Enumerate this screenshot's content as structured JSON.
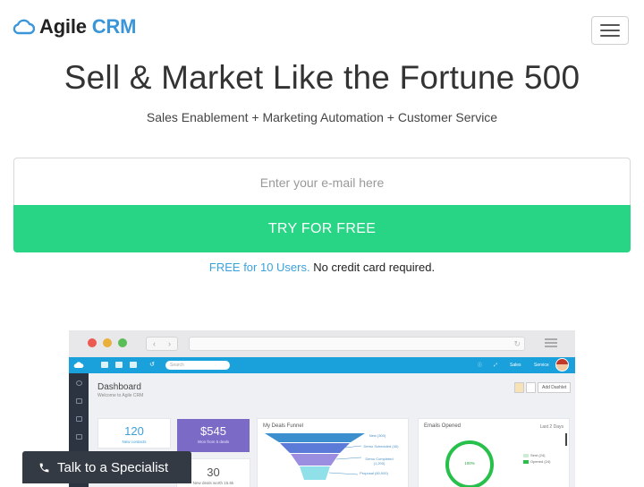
{
  "header": {
    "logo_word1": "Agile",
    "logo_word2": "CRM",
    "menu_icon": "hamburger-menu-icon"
  },
  "hero": {
    "headline": "Sell & Market Like the Fortune 500",
    "subheadline": "Sales Enablement + Marketing Automation + Customer Service"
  },
  "signup": {
    "email_placeholder": "Enter your e-mail here",
    "email_value": "",
    "cta_label": "TRY FOR FREE",
    "note_highlight": "FREE for 10 Users.",
    "note_rest": "No credit card required."
  },
  "preview": {
    "search_placeholder": "Search",
    "nav_sales": "Sales",
    "nav_service": "Service",
    "dashboard_title": "Dashboard",
    "dashboard_subtitle": "Welcome to Agile CRM",
    "add_dashlet_label": "Add Dashlet",
    "stats": [
      {
        "value": "120",
        "label": "New contacts"
      },
      {
        "value": "$545",
        "label": "Won from 5 deals"
      },
      {
        "value": "30",
        "label": "New deals worth 15.6k"
      }
    ],
    "funnel_title": "My Deals Funnel",
    "funnel_labels": [
      "New (300)",
      "Demo Scheduled (40)",
      "Demo Completed (1,200)",
      "Proposal (60,000)"
    ],
    "emails_title": "Emails Opened",
    "emails_range": "Last 2 Days",
    "emails_percent": "100%",
    "emails_legend": [
      "Sent (24)",
      "Opened (24)"
    ]
  },
  "specialist": {
    "label": "Talk to a Specialist",
    "icon": "phone-icon"
  },
  "colors": {
    "brand_blue": "#3b96d9",
    "cta_green": "#27d585",
    "link_blue": "#3aa2dd",
    "app_bar": "#1aa0db",
    "specialist_bg": "#333a44"
  }
}
